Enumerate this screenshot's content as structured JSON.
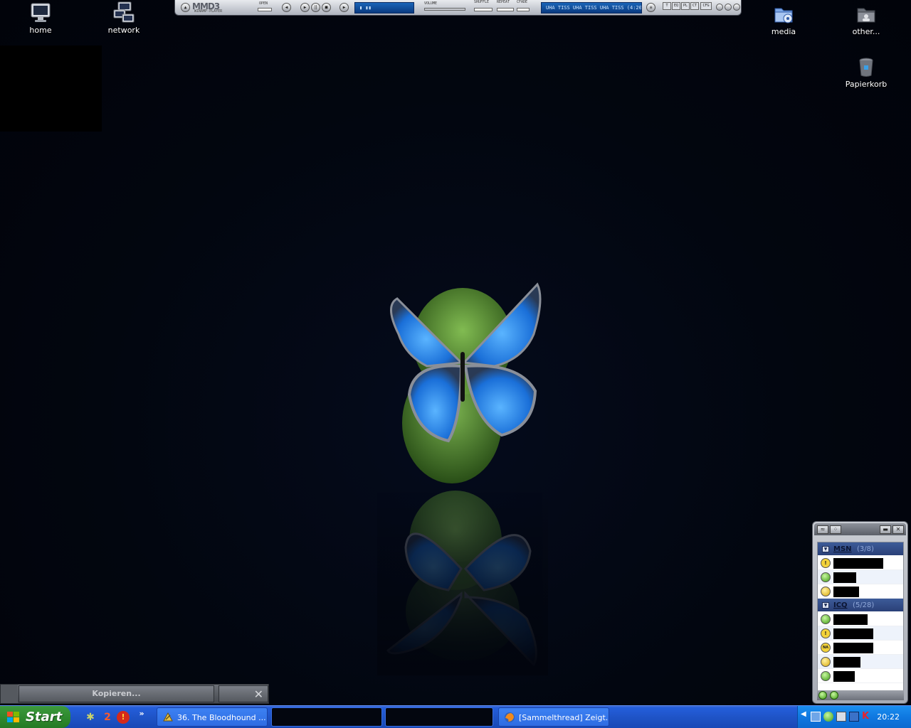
{
  "desktop_icons": {
    "home": "home",
    "network": "network",
    "media": "media",
    "other": "other...",
    "recycle": "Papierkorb"
  },
  "winamp": {
    "logo": "MMD3",
    "subtitle": "WINAMP-PLAYER",
    "open_label": "OPEN",
    "volume_label": "VOLUME",
    "shuffle_label": "SHUFFLE",
    "repeat_label": "REPEAT",
    "crossfade_label": "CFADE",
    "track_title": "UHA TISS UHA TISS UHA TISS (4:20)",
    "buttons": [
      "T",
      "EQ",
      "PL",
      "CT",
      "CFG"
    ]
  },
  "copy_dialog": {
    "label": "Kopieren..."
  },
  "contacts": {
    "groups": [
      {
        "name": "MSN",
        "count": "(3/8)"
      },
      {
        "name": "ICQ",
        "count": "(5/28)"
      }
    ]
  },
  "taskbar": {
    "start_label": "Start",
    "quick_launch_count": "2",
    "tasks": [
      "36. The Bloodhound ...",
      "",
      "",
      "[Sammelthread] Zeigt..."
    ],
    "clock": "20:22"
  },
  "colors": {
    "taskbar_blue": "#245edb",
    "start_green": "#2f8a2f",
    "tray_blue": "#0f78e0"
  }
}
